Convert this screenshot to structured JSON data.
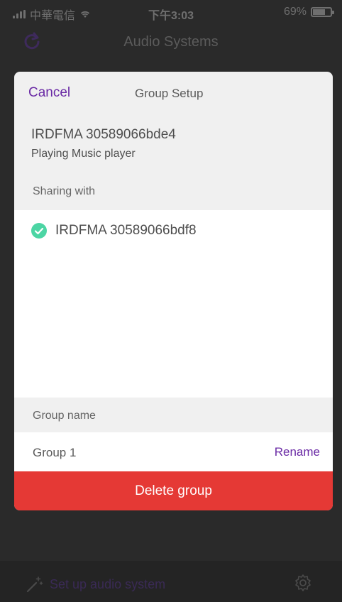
{
  "status_bar": {
    "carrier": "中華電信",
    "time": "下午3:03",
    "battery": "69%",
    "battery_level": 0.69
  },
  "nav": {
    "title": "Audio Systems",
    "refresh_icon": "refresh-icon"
  },
  "bottom_bar": {
    "setup_label": "Set up audio system",
    "wand_icon": "magic-wand-icon",
    "settings_icon": "gear-icon"
  },
  "modal": {
    "cancel_label": "Cancel",
    "title": "Group Setup",
    "device_name": "IRDFMA 30589066bde4",
    "device_status": "Playing Music player",
    "sharing_label": "Sharing with",
    "sharing_items": [
      {
        "label": "IRDFMA 30589066bdf8",
        "checked": true
      }
    ],
    "group_name_label": "Group name",
    "group_name_value": "Group 1",
    "rename_label": "Rename",
    "delete_label": "Delete group"
  },
  "colors": {
    "accent": "#6a2aa5",
    "danger": "#e53935",
    "check": "#4cd5a4"
  }
}
